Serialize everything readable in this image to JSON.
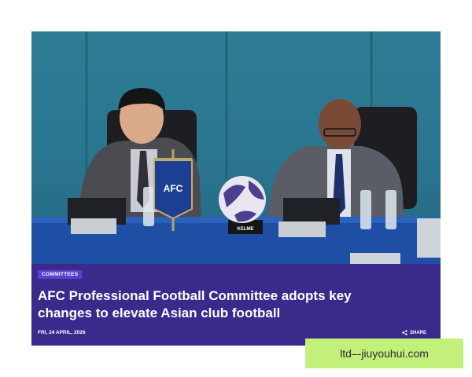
{
  "article": {
    "tag": "COMMITTEES",
    "headline": "AFC Professional Football Committee adopts key changes to elevate Asian club football",
    "date": "FRI, 24 APRIL, 2026",
    "share_label": "SHARE"
  },
  "photo": {
    "pennant_text": "AFC",
    "ball_brand": "KELME"
  },
  "watermark": {
    "text": "ltd–-jiuyouhui.com"
  },
  "colors": {
    "caption_bg": "#3a2a8c",
    "tag_bg": "#5b3fd0",
    "watermark_bg": "#c3f07a"
  },
  "icons": {
    "share": "share-icon"
  }
}
